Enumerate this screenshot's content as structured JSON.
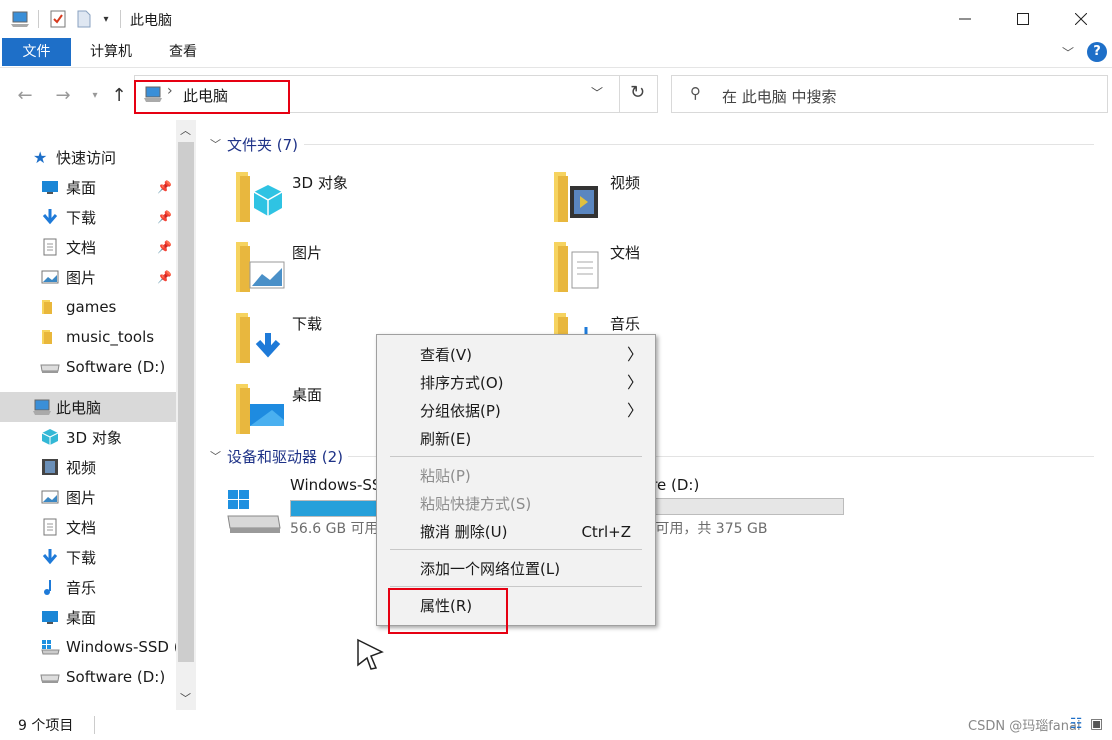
{
  "window": {
    "title": "此电脑"
  },
  "ribbon": {
    "tabs": [
      {
        "label": "文件"
      },
      {
        "label": "计算机"
      },
      {
        "label": "查看"
      }
    ]
  },
  "address": {
    "crumb_sep": "›",
    "location": "此电脑"
  },
  "search": {
    "placeholder": "在 此电脑 中搜索"
  },
  "nav": {
    "quick_access": "快速访问",
    "items": [
      {
        "label": "桌面",
        "icon": "desktop-icon",
        "pinned": true
      },
      {
        "label": "下载",
        "icon": "download-icon",
        "pinned": true
      },
      {
        "label": "文档",
        "icon": "document-icon",
        "pinned": true
      },
      {
        "label": "图片",
        "icon": "picture-icon",
        "pinned": true
      },
      {
        "label": "games",
        "icon": "folder-icon"
      },
      {
        "label": "music_tools",
        "icon": "folder-icon"
      },
      {
        "label": "Software (D:)",
        "icon": "drive-icon"
      },
      {
        "label": "此电脑",
        "icon": "computer-icon",
        "selected": true
      },
      {
        "label": "3D 对象",
        "icon": "cube-icon"
      },
      {
        "label": "视频",
        "icon": "video-icon"
      },
      {
        "label": "图片",
        "icon": "picture-icon"
      },
      {
        "label": "文档",
        "icon": "document-icon"
      },
      {
        "label": "下载",
        "icon": "download-icon"
      },
      {
        "label": "音乐",
        "icon": "music-icon"
      },
      {
        "label": "桌面",
        "icon": "desktop-icon"
      },
      {
        "label": "Windows-SSD (",
        "icon": "windows-drive-icon"
      },
      {
        "label": "Software (D:)",
        "icon": "drive-icon"
      }
    ]
  },
  "content": {
    "folders_header": "文件夹 (7)",
    "folders": [
      {
        "label": "3D 对象"
      },
      {
        "label": "视频"
      },
      {
        "label": "图片"
      },
      {
        "label": "文档"
      },
      {
        "label": "下载"
      },
      {
        "label": "音乐"
      },
      {
        "label": "桌面"
      }
    ],
    "devices_header": "设备和驱动器 (2)",
    "drives": [
      {
        "name": "Windows-SS",
        "free": "56.6 GB 可用",
        "used_fraction": 0.62
      },
      {
        "name": "are (D:)",
        "free": "3 可用，共 375 GB",
        "used_fraction": 0.0
      }
    ]
  },
  "context_menu": {
    "items": [
      {
        "label": "查看(V)",
        "submenu": true
      },
      {
        "label": "排序方式(O)",
        "submenu": true
      },
      {
        "label": "分组依据(P)",
        "submenu": true
      },
      {
        "label": "刷新(E)"
      },
      {
        "label": "粘贴(P)",
        "disabled": true
      },
      {
        "label": "粘贴快捷方式(S)",
        "disabled": true
      },
      {
        "label": "撤消 删除(U)",
        "shortcut": "Ctrl+Z"
      },
      {
        "label": "添加一个网络位置(L)"
      },
      {
        "label": "属性(R)"
      }
    ]
  },
  "status": {
    "count": "9 个项目",
    "watermark": "CSDN @玛瑙fanai"
  },
  "colors": {
    "accent": "#1e6fc8",
    "highlight_box": "#e60012",
    "drive_bar": "#26a0da"
  }
}
